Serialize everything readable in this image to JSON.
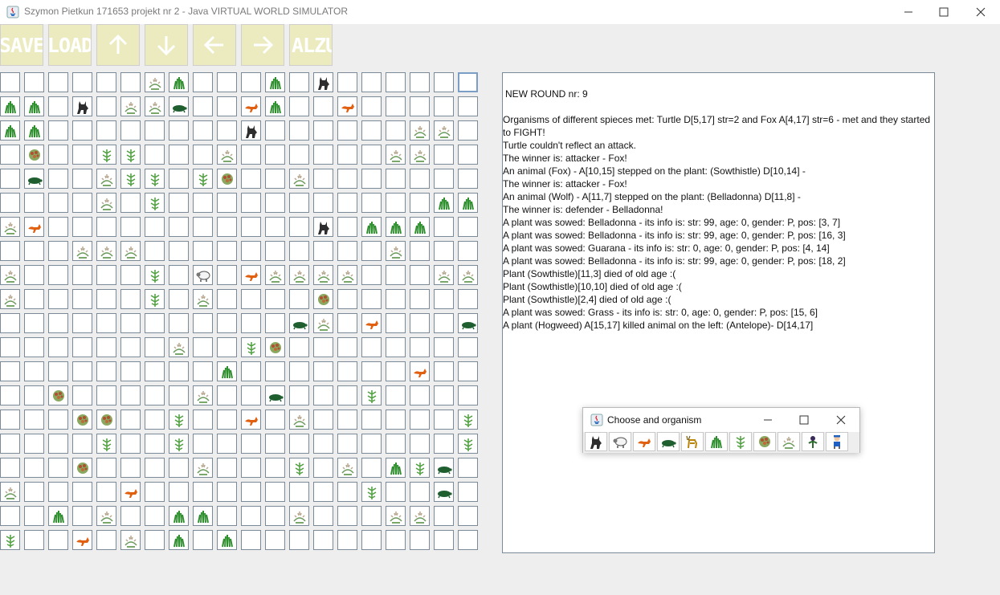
{
  "window": {
    "title": "Szymon Pietkun 171653 projekt nr 2 - Java  VIRTUAL WORLD SIMULATOR",
    "minimize_icon": "minimize-icon",
    "maximize_icon": "maximize-icon",
    "close_icon": "close-icon"
  },
  "toolbar": {
    "save_label": "SAVE",
    "load_label": "LOAD",
    "up_icon": "arrow-up-icon",
    "down_icon": "arrow-down-icon",
    "left_icon": "arrow-left-icon",
    "right_icon": "arrow-right-icon",
    "alzur_label": "ALZUR"
  },
  "legend": {
    "wolf": "W",
    "sheep": "S",
    "fox": "F",
    "turtle": "T",
    "antelope": "A",
    "grass": "g",
    "sowthistle": "s",
    "guarana": "u",
    "belladonna": "b",
    "hogweed": "h",
    "human": "H",
    "empty": "."
  },
  "board": {
    "rows": [
      ". . . . . . s g . . . g . W . . . . . .",
      "g g . W . s s T . . F g . . F . . . . .",
      "g g . . . . . . . . W . . . . . . s s .",
      ". u . . h h . . . s . . . . . . s s . .",
      ". T . . s h h . h u . . s . . . . . . .",
      ". . . . s . h . . . . . . . . . . . g g",
      "s F . . . . . . . . . . . W . g g g . .",
      ". . . s s s . . . . . . . . . . s . . .",
      "s . . . . . h . S . F s s s s . . . s s",
      "s . . . . . h . s . . . . u . . . . . .",
      ". . . . . . . . . . . . T s . F . . . T",
      ". . . . . . . s . . h u . . . . . . . .",
      ". . . . . . . . . g . . . . . . . F . .",
      ". . u . . . . . s . . T . . . h . . . .",
      ". . . u u . . h . . F . s . . . . . . h",
      ". . . . h . . h . . . . . . . . . . . h",
      ". . . u . . . . s . . . h . s . g h T .",
      "s . . . . F . . . . . . . . . h . . T .",
      ". . g . s . . g g . . . s . . . s s . .",
      "h . . F . s . g . g . . . . . . . . . ."
    ],
    "focused_cell": [
      0,
      19
    ]
  },
  "log": {
    "round": "NEW ROUND nr: 9",
    "lines": [
      "Organisms of different spieces met: Turtle D[5,17] str=2 and Fox A[4,17] str=6 - met and they started to FIGHT!",
      "Turtle couldn't reflect an attack.",
      "The winner is: attacker - Fox!",
      "An animal (Fox) - A[10,15] stepped on the plant: (Sowthistle) D[10,14] -",
      "The winner is: attacker - Fox!",
      "An animal (Wolf) - A[11,7] stepped on the plant: (Belladonna) D[11,8] -",
      "The winner is: defender - Belladonna!",
      "A plant was sowed: Belladonna - its info is: str: 99, age: 0, gender: P, pos: [3, 7]",
      "A plant was sowed: Belladonna - its info is: str: 99, age: 0, gender: P, pos: [16, 3]",
      "A plant was sowed: Guarana - its info is: str: 0, age: 0, gender: P, pos: [4, 14]",
      "A plant was sowed: Belladonna - its info is: str: 99, age: 0, gender: P, pos: [18, 2]",
      "Plant (Sowthistle)[11,3] died of old age :(",
      "Plant (Sowthistle)[10,10] died of old age :(",
      "Plant (Sowthistle)[2,4] died of old age :(",
      "A plant was sowed: Grass - its info is: str: 0, age: 0, gender: P, pos: [15, 6]",
      "A plant (Hogweed) A[15,17] killed animal on the left: (Antelope)- D[14,17]"
    ]
  },
  "chooser": {
    "title": "Choose and organism",
    "items": [
      "W",
      "S",
      "F",
      "T",
      "A",
      "g",
      "h",
      "u",
      "s",
      "b",
      "H"
    ]
  },
  "colors": {
    "button_bg": "#ecebc0",
    "grass": "#2f8f2f",
    "fox": "#e06010",
    "wolf": "#333333",
    "turtle": "#1f5f2f",
    "guarana": "#a05030"
  }
}
